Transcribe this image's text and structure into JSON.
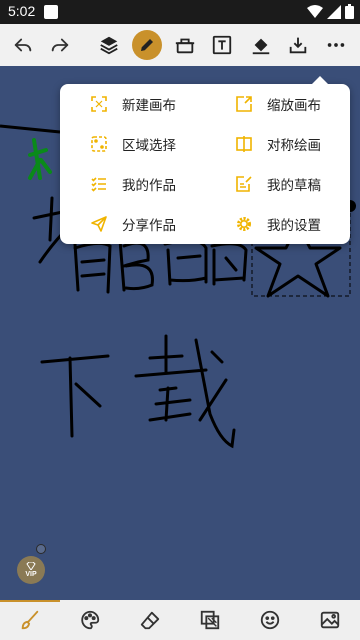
{
  "status_bar": {
    "time": "5:02"
  },
  "toolbar": {
    "icons": [
      "undo-icon",
      "redo-icon",
      "layers-icon",
      "pen-icon",
      "eraser-icon",
      "text-icon",
      "fill-icon",
      "download-icon",
      "more-icon"
    ],
    "accent": "#c9912b"
  },
  "menu": {
    "items": [
      {
        "label": "新建画布",
        "icon": "new-canvas-icon"
      },
      {
        "label": "缩放画布",
        "icon": "resize-canvas-icon"
      },
      {
        "label": "区域选择",
        "icon": "area-select-icon"
      },
      {
        "label": "对称绘画",
        "icon": "symmetry-icon"
      },
      {
        "label": "我的作品",
        "icon": "my-works-icon"
      },
      {
        "label": "我的草稿",
        "icon": "my-drafts-icon"
      },
      {
        "label": "分享作品",
        "icon": "share-icon"
      },
      {
        "label": "我的设置",
        "icon": "settings-icon"
      }
    ],
    "icon_color": "#f0b400"
  },
  "vip": {
    "label": "VIP"
  },
  "bottom_bar": {
    "icons": [
      "brush-icon",
      "palette-icon",
      "eraser-icon",
      "layers-copy-icon",
      "emoji-icon",
      "image-icon"
    ]
  }
}
